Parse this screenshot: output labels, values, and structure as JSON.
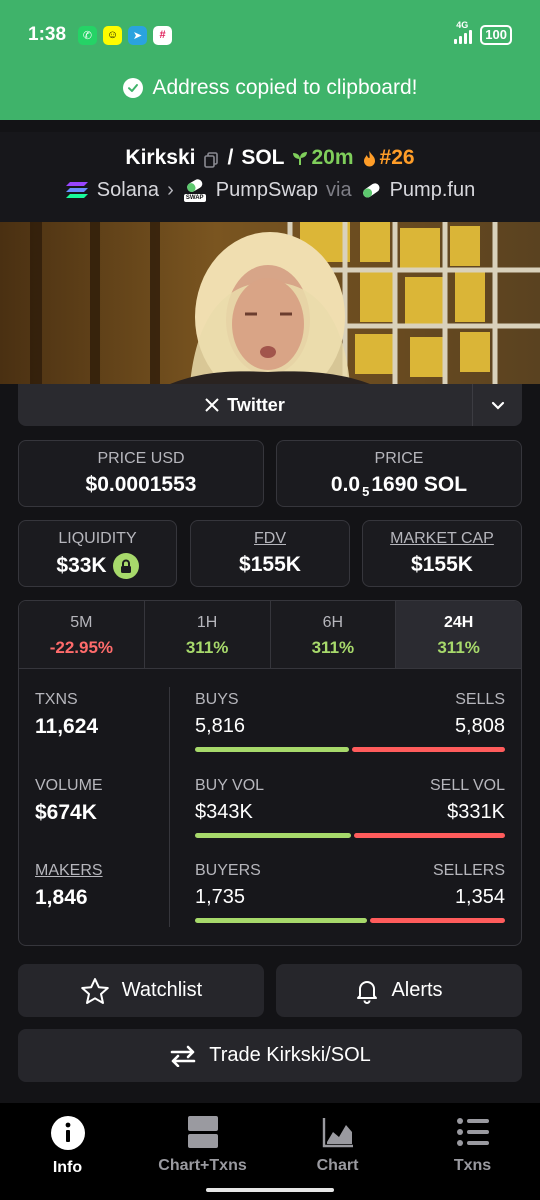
{
  "status_bar": {
    "time": "1:38",
    "network": "4G",
    "battery": "100",
    "app_icons": [
      "whatsapp-icon",
      "snapchat-icon",
      "telegram-icon",
      "slack-icon"
    ]
  },
  "toast": {
    "message": "Address copied to clipboard!"
  },
  "header": {
    "token": "Kirkski",
    "separator": "/",
    "quote": "SOL",
    "age": "20m",
    "rank": "#26",
    "chain": "Solana",
    "dex": "PumpSwap",
    "dex_badge": "SWAP",
    "via": "via",
    "launchpad": "Pump.fun"
  },
  "socials": {
    "twitter_label": "Twitter"
  },
  "price": {
    "usd_label": "PRICE USD",
    "usd_value": "$0.0001553",
    "native_label": "PRICE",
    "native_prefix": "0.0",
    "native_zeros": "5",
    "native_rest": "1690 SOL"
  },
  "metrics": {
    "liquidity_label": "LIQUIDITY",
    "liquidity_value": "$33K",
    "fdv_label": "FDV",
    "fdv_value": "$155K",
    "mcap_label": "MARKET CAP",
    "mcap_value": "$155K"
  },
  "timeframes": [
    {
      "label": "5M",
      "value": "-22.95%"
    },
    {
      "label": "1H",
      "value": "311%"
    },
    {
      "label": "6H",
      "value": "311%"
    },
    {
      "label": "24H",
      "value": "311%"
    }
  ],
  "stats": {
    "txns_label": "TXNS",
    "txns_value": "11,624",
    "volume_label": "VOLUME",
    "volume_value": "$674K",
    "makers_label": "MAKERS",
    "makers_value": "1,846",
    "buys_label": "BUYS",
    "buys_value": "5,816",
    "sells_label": "SELLS",
    "sells_value": "5,808",
    "buy_vol_label": "BUY VOL",
    "buy_vol_value": "$343K",
    "sell_vol_label": "SELL VOL",
    "sell_vol_value": "$331K",
    "buyers_label": "BUYERS",
    "buyers_value": "1,735",
    "sellers_label": "SELLERS",
    "sellers_value": "1,354"
  },
  "actions": {
    "watchlist": "Watchlist",
    "alerts": "Alerts",
    "trade": "Trade Kirkski/SOL"
  },
  "nav": [
    {
      "label": "Info"
    },
    {
      "label": "Chart+Txns"
    },
    {
      "label": "Chart"
    },
    {
      "label": "Txns"
    }
  ],
  "colors": {
    "banner": "#3fb36a",
    "positive": "#a7d96b",
    "negative": "#ff6b6b",
    "rank": "#ff9d28"
  }
}
